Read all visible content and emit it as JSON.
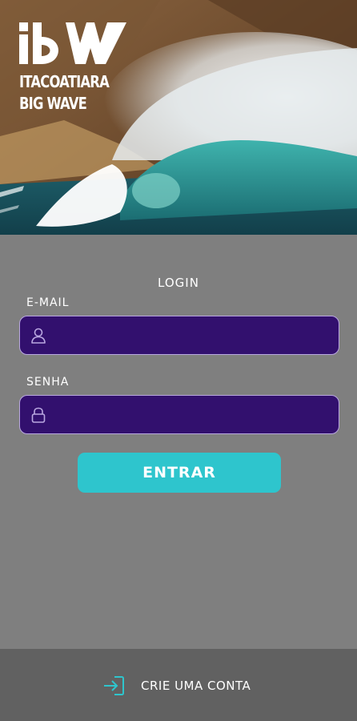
{
  "hero": {
    "logo_line1": "ITACOATIARA",
    "logo_line2": "BIG WAVE",
    "logo_mark": "IBW"
  },
  "login": {
    "title": "LOGIN",
    "email": {
      "label": "E-MAIL",
      "value": "",
      "icon": "user-icon"
    },
    "password": {
      "label": "SENHA",
      "value": "",
      "icon": "lock-icon"
    },
    "submit_label": "ENTRAR"
  },
  "footer": {
    "create_account_label": "CRIE UMA CONTA",
    "icon": "sign-in-icon"
  },
  "colors": {
    "background": "#7f7f7f",
    "field_bg": "#32106e",
    "field_border": "#b9a7e0",
    "accent": "#2ec5cd",
    "footer_bg": "#616161"
  }
}
